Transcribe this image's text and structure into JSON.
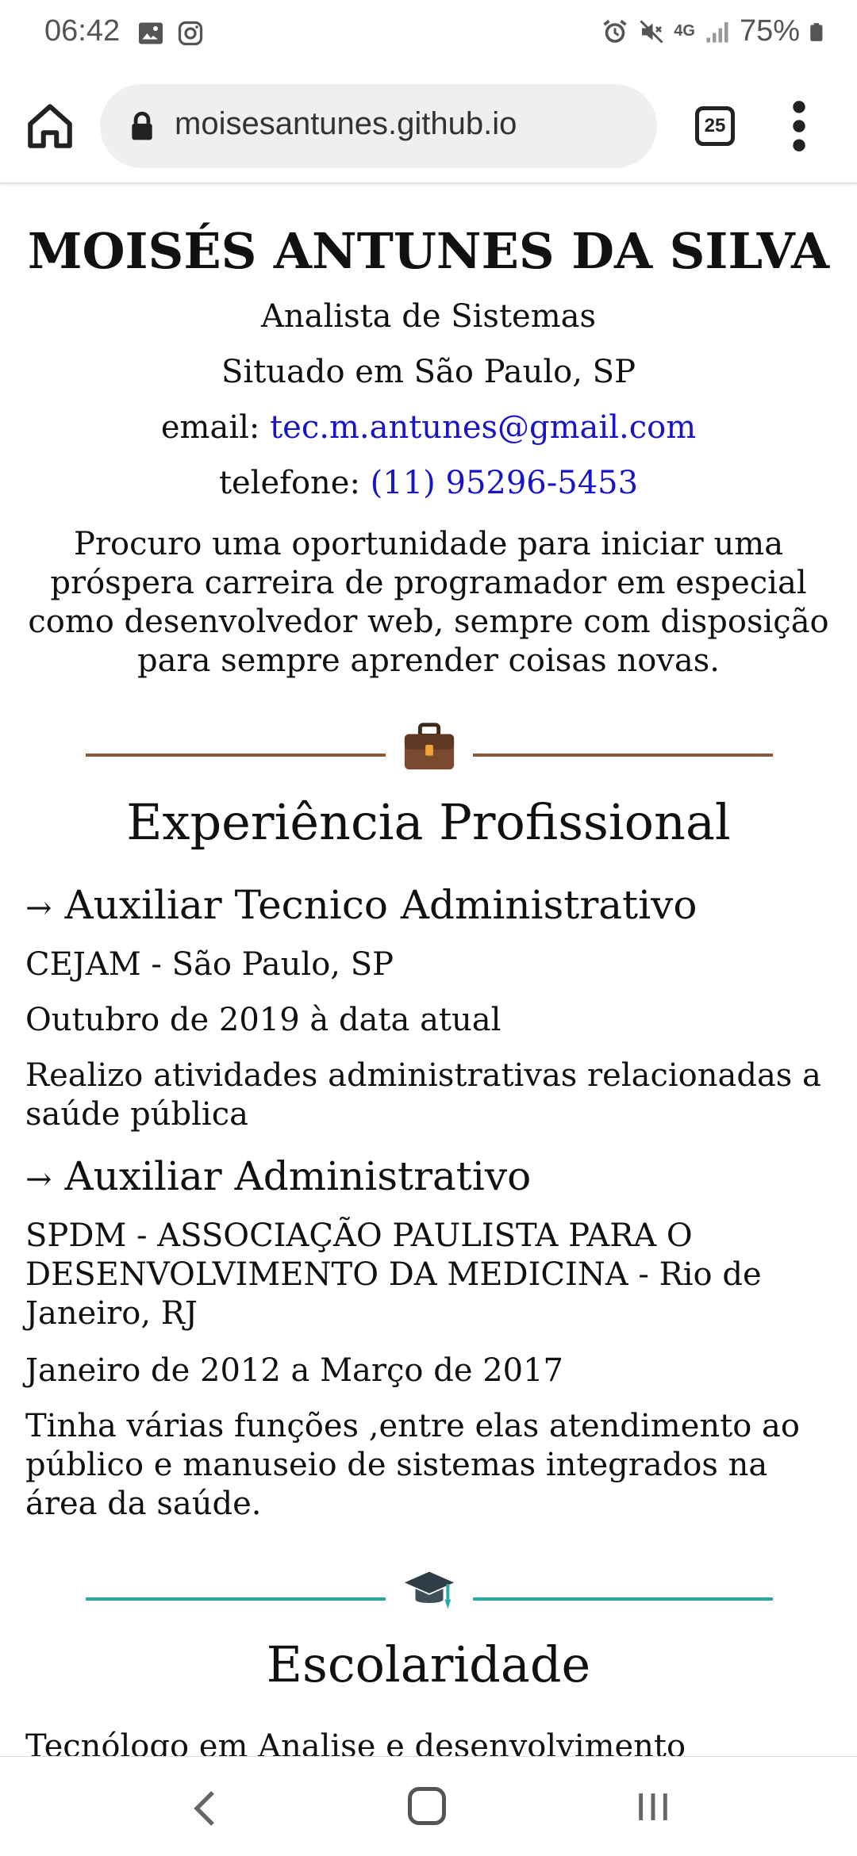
{
  "status": {
    "time": "06:42",
    "battery": "75%",
    "network": "4G"
  },
  "browser": {
    "url": "moisesantunes.github.io",
    "tab_count": "25"
  },
  "profile": {
    "name": "MOISÉS ANTUNES DA SILVA",
    "role": "Analista de Sistemas",
    "location": "Situado em São Paulo, SP",
    "email_label": "email: ",
    "email": "tec.m.antunes@gmail.com",
    "phone_label": "telefone: ",
    "phone": "(11) 95296-5453",
    "objective": "Procuro uma oportunidade para iniciar uma próspera carreira de programador em especial como desenvolvedor web, sempre com disposição para sempre aprender coisas novas."
  },
  "experience": {
    "title": "Experiência Profissional",
    "arrow": "→",
    "jobs": [
      {
        "title": "Auxiliar Tecnico Administrativo",
        "company": "CEJAM - São Paulo, SP",
        "period": "Outubro de 2019 à data atual",
        "description": "Realizo atividades administrativas relacionadas a saúde pública"
      },
      {
        "title": "Auxiliar Administrativo",
        "company": "SPDM - ASSOCIAÇÃO PAULISTA PARA O DESENVOLVIMENTO DA MEDICINA - Rio de Janeiro, RJ",
        "period": "Janeiro de 2012 a Março de 2017",
        "description": "Tinha várias funções ,entre elas atendimento ao público e manuseio de sistemas integrados na área da saúde."
      }
    ]
  },
  "education": {
    "title": "Escolaridade",
    "first_item": "Tecnólogo em Analise e desenvolvimento"
  },
  "colors": {
    "work_divider": "#8a5a3c",
    "edu_divider": "#2aa8a8",
    "link": "#1a14c8"
  },
  "icons": {
    "work": "briefcase-icon",
    "education": "graduation-cap-icon"
  }
}
